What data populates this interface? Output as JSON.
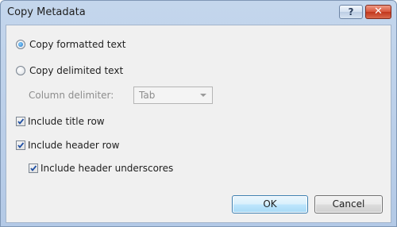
{
  "window": {
    "title": "Copy Metadata",
    "help_label": "?",
    "close_label": "✕"
  },
  "options": {
    "copy_formatted": {
      "label": "Copy formatted text",
      "selected": true
    },
    "copy_delimited": {
      "label": "Copy delimited text",
      "selected": false
    },
    "column_delimiter": {
      "label": "Column delimiter:",
      "value": "Tab",
      "enabled": false
    },
    "include_title_row": {
      "label": "Include title row",
      "checked": true
    },
    "include_header_row": {
      "label": "Include header row",
      "checked": true
    },
    "include_header_underscores": {
      "label": "Include header underscores",
      "checked": true
    }
  },
  "buttons": {
    "ok": "OK",
    "cancel": "Cancel"
  },
  "colors": {
    "title_bar": "#c4d6ec",
    "close_button": "#c1361c",
    "checkmark": "#1f4fa3"
  }
}
